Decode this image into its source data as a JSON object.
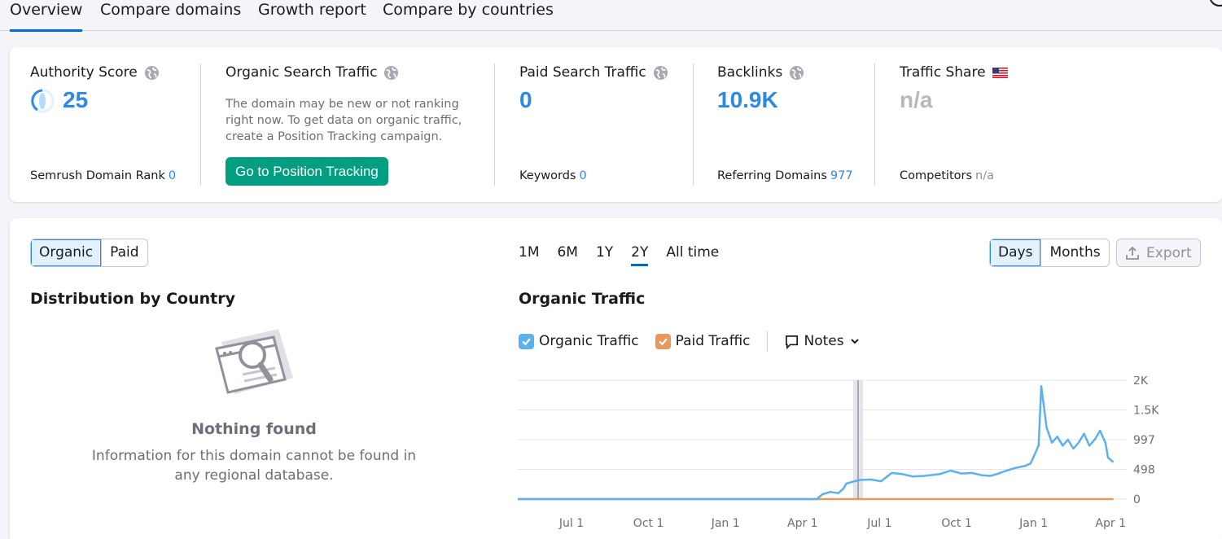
{
  "tabs": [
    {
      "label": "Overview",
      "active": true
    },
    {
      "label": "Compare domains",
      "active": false
    },
    {
      "label": "Growth report",
      "active": false
    },
    {
      "label": "Compare by countries",
      "active": false
    }
  ],
  "summary": {
    "authority": {
      "label": "Authority Score",
      "value": "25",
      "sub_label": "Semrush Domain Rank",
      "sub_value": "0"
    },
    "organic": {
      "label": "Organic Search Traffic",
      "description": "The domain may be new or not ranking right now. To get data on organic traffic, create a Position Tracking campaign.",
      "cta": "Go to Position Tracking"
    },
    "paid": {
      "label": "Paid Search Traffic",
      "value": "0",
      "sub_label": "Keywords",
      "sub_value": "0"
    },
    "backlinks": {
      "label": "Backlinks",
      "value": "10.9K",
      "sub_label": "Referring Domains",
      "sub_value": "977"
    },
    "share": {
      "label": "Traffic Share",
      "value": "n/a",
      "sub_label": "Competitors",
      "sub_value": "n/a",
      "flag_icon": "us-flag-icon"
    }
  },
  "controls": {
    "source_toggle": [
      "Organic",
      "Paid"
    ],
    "source_selected": "Organic",
    "ranges": [
      "1M",
      "6M",
      "1Y",
      "2Y",
      "All time"
    ],
    "range_selected": "2Y",
    "granularity": [
      "Days",
      "Months"
    ],
    "granularity_selected": "Days",
    "export_label": "Export"
  },
  "distribution": {
    "title": "Distribution by Country",
    "empty_title": "Nothing found",
    "empty_text": "Information for this domain cannot be found in any regional database."
  },
  "traffic": {
    "title": "Organic Traffic",
    "legend": [
      {
        "label": "Organic Traffic",
        "color": "#5bb1ee",
        "checked": true
      },
      {
        "label": "Paid Traffic",
        "color": "#e8985a",
        "checked": true
      }
    ],
    "notes_label": "Notes"
  },
  "chart_data": {
    "type": "line",
    "x_ticks": [
      "Jul 1",
      "Oct 1",
      "Jan 1",
      "Apr 1",
      "Jul 1",
      "Oct 1",
      "Jan 1",
      "Apr 1"
    ],
    "y_ticks": [
      "2K",
      "1.5K",
      "997",
      "498",
      "0"
    ],
    "ylim": [
      0,
      2000
    ],
    "grid": true,
    "series": [
      {
        "name": "Organic Traffic",
        "color": "#5bb1ee",
        "points": [
          [
            0,
            0
          ],
          [
            5.6,
            0
          ],
          [
            5.7,
            80
          ],
          [
            5.85,
            120
          ],
          [
            6.0,
            100
          ],
          [
            6.1,
            180
          ],
          [
            6.15,
            260
          ],
          [
            6.3,
            300
          ],
          [
            6.4,
            320
          ],
          [
            6.6,
            330
          ],
          [
            6.8,
            300
          ],
          [
            7.0,
            440
          ],
          [
            7.2,
            420
          ],
          [
            7.4,
            380
          ],
          [
            7.6,
            390
          ],
          [
            7.9,
            420
          ],
          [
            8.0,
            450
          ],
          [
            8.1,
            480
          ],
          [
            8.3,
            430
          ],
          [
            8.5,
            440
          ],
          [
            8.7,
            400
          ],
          [
            8.85,
            390
          ],
          [
            9.0,
            430
          ],
          [
            9.15,
            480
          ],
          [
            9.3,
            520
          ],
          [
            9.5,
            560
          ],
          [
            9.6,
            600
          ],
          [
            9.75,
            900
          ],
          [
            9.8,
            1900
          ],
          [
            9.9,
            1200
          ],
          [
            10.0,
            950
          ],
          [
            10.1,
            1050
          ],
          [
            10.2,
            900
          ],
          [
            10.3,
            1000
          ],
          [
            10.4,
            850
          ],
          [
            10.5,
            950
          ],
          [
            10.6,
            1100
          ],
          [
            10.7,
            900
          ],
          [
            10.8,
            1000
          ],
          [
            10.9,
            1150
          ],
          [
            11.0,
            950
          ],
          [
            11.05,
            700
          ],
          [
            11.15,
            620
          ]
        ]
      },
      {
        "name": "Paid Traffic",
        "color": "#e8985a",
        "points": [
          [
            0,
            0
          ],
          [
            11.15,
            0
          ]
        ]
      }
    ]
  }
}
